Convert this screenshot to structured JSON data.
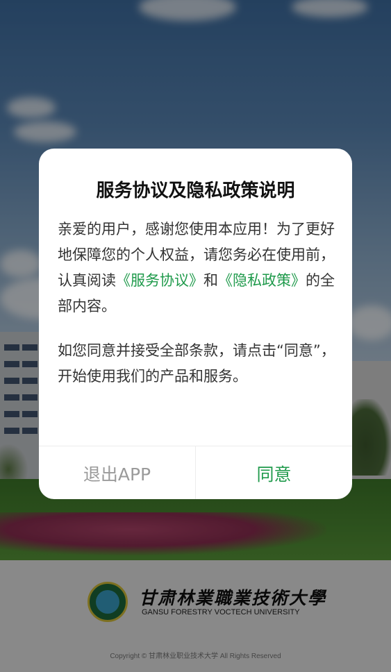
{
  "dialog": {
    "title": "服务协议及隐私政策说明",
    "para1_part1": "亲爱的用户，感谢您使用本应用！为了更好地保障您的个人权益，请您务必在使用前，认真阅读",
    "service_link": "《服务协议》",
    "para1_and": "和",
    "privacy_link": "《隐私政策》",
    "para1_end": "的全部内容。",
    "para2": "如您同意并接受全部条款，请点击“同意”，开始使用我们的产品和服务。",
    "exit_label": "退出APP",
    "agree_label": "同意"
  },
  "footer": {
    "university_cn": "甘肃林業職業技術大學",
    "university_en": "GANSU FORESTRY VOCTECH UNIVERSITY",
    "copyright": "Copyright © 甘肃林业职业技术大学 All Rights Reserved"
  },
  "colors": {
    "accent": "#1f9a4b",
    "secondary_button": "#9a9a9a"
  }
}
